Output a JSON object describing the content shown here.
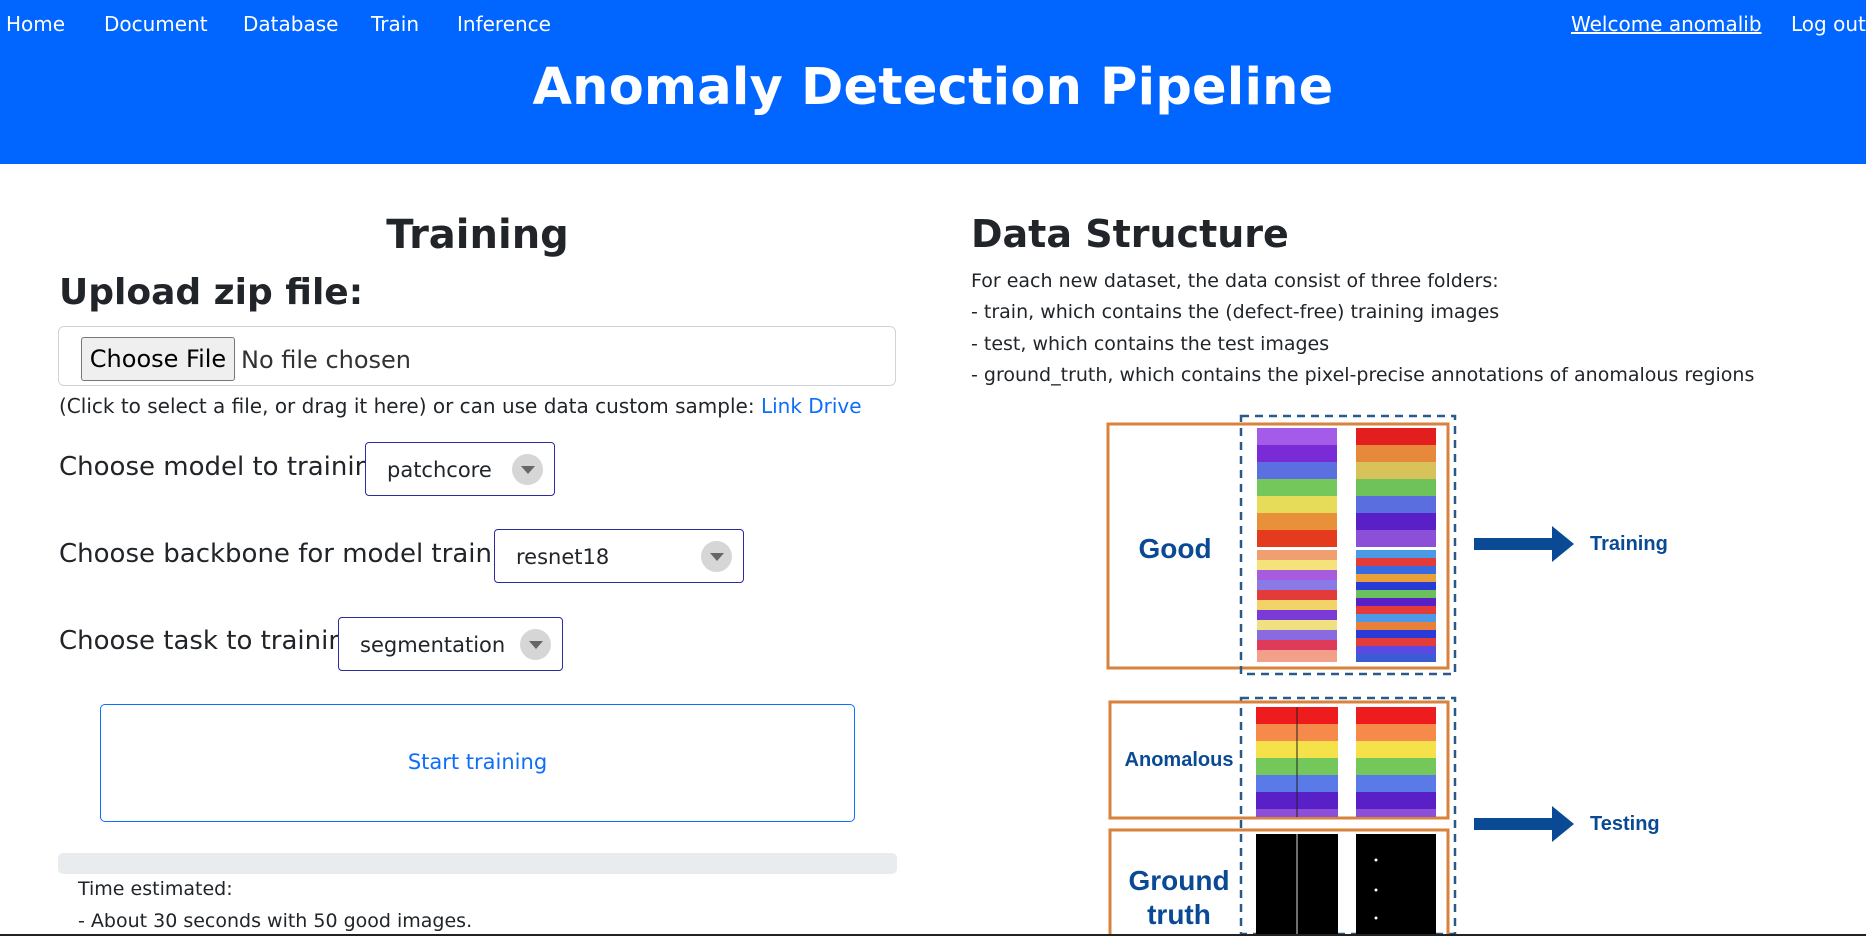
{
  "nav": {
    "home": "Home",
    "document": "Document",
    "database": "Database",
    "train": "Train",
    "inference": "Inference",
    "welcome": "Welcome anomalib",
    "logout": "Log out"
  },
  "header": {
    "title": "Anomaly Detection Pipeline"
  },
  "training": {
    "heading": "Training",
    "upload_heading": "Upload zip file:",
    "choose_file": "Choose File",
    "no_file": "No file chosen",
    "hint_text": "(Click to select a file, or drag it here) or can use data custom sample:",
    "hint_link": "Link Drive",
    "model_label": "Choose model to training:",
    "model_value": "patchcore",
    "backbone_label": "Choose backbone for model training:",
    "backbone_value": "resnet18",
    "task_label": "Choose task to training:",
    "task_value": "segmentation",
    "start_button": "Start training",
    "time_title": "Time estimated:",
    "time_line1": "- About 30 seconds with 50 good images."
  },
  "data_structure": {
    "heading": "Data Structure",
    "lines": [
      "For each new dataset, the data consist of three folders:",
      "- train, which contains the (defect-free) training images",
      "- test, which contains the test images",
      "- ground_truth, which contains the pixel-precise annotations of anomalous regions"
    ],
    "diagram": {
      "good": "Good",
      "anomalous": "Anomalous",
      "ground_truth_1": "Ground",
      "ground_truth_2": "truth",
      "training": "Training",
      "testing": "Testing"
    }
  },
  "colors": {
    "primary": "#0066ff",
    "link": "#0d6efd",
    "frame": "#d9823b",
    "label": "#0a4a94"
  }
}
